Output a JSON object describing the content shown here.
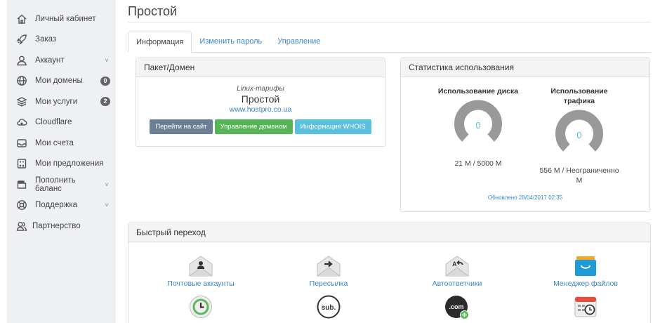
{
  "sidebar": {
    "items": [
      {
        "label": "Личный кабинет",
        "icon": "home-icon"
      },
      {
        "label": "Заказ",
        "icon": "rocket-icon"
      },
      {
        "label": "Аккаунт",
        "icon": "user-icon",
        "chevron": "˅"
      },
      {
        "label": "Мои домены",
        "icon": "globe-icon",
        "badge": "0"
      },
      {
        "label": "Мои услуги",
        "icon": "layers-icon",
        "badge": "2"
      },
      {
        "label": "Cloudflare",
        "icon": "cloud-icon"
      },
      {
        "label": "Мои счета",
        "icon": "inbox-icon"
      },
      {
        "label": "Мои предложения",
        "icon": "calculator-icon"
      },
      {
        "label": "Пополнить баланс",
        "icon": "wallet-icon",
        "chevron": "˅"
      },
      {
        "label": "Поддержка",
        "icon": "lifebuoy-icon",
        "chevron": "˅"
      },
      {
        "label": "Партнерство",
        "icon": "users-icon"
      }
    ]
  },
  "page": {
    "title": "Простой"
  },
  "tabs": [
    {
      "label": "Информация"
    },
    {
      "label": "Изменить пароль"
    },
    {
      "label": "Управление"
    }
  ],
  "package": {
    "heading": "Пакет/Домен",
    "group": "Linux-тарифы",
    "name": "Простой",
    "domain": "www.hostpro.co.ua",
    "buttons": {
      "goto_site": "Перейти на сайт",
      "manage_domain": "Управление доменом",
      "whois": "Информация WHOIS"
    }
  },
  "stats": {
    "heading": "Статистика использования",
    "disk": {
      "title": "Использование диска",
      "gauge_value": "0",
      "usage": "21 M / 5000 M"
    },
    "traffic": {
      "title_line1": "Использование",
      "title_line2": "трафика",
      "gauge_value": "0",
      "usage_line1": "556 M / Неограниченно",
      "usage_line2": "M"
    },
    "updated": "Обновлено 28/04/2017 02:35"
  },
  "quick": {
    "heading": "Быстрый переход",
    "items": [
      {
        "label": "Почтовые аккаунты",
        "icon": "mail-account-icon"
      },
      {
        "label": "Пересылка",
        "icon": "mail-forward-icon"
      },
      {
        "label": "Автоответчики",
        "icon": "mail-autoreply-icon"
      },
      {
        "label": "Менеджер файлов",
        "icon": "file-manager-icon"
      },
      {
        "label": "",
        "icon": "cron-clock-icon"
      },
      {
        "label": "",
        "icon": "subdomain-icon",
        "text": "sub."
      },
      {
        "label": "",
        "icon": "addon-domain-icon",
        "text": ".com"
      },
      {
        "label": "",
        "icon": "calendar-clock-icon"
      }
    ]
  },
  "colors": {
    "accent": "#3a86c4",
    "sidebar_bg": "#eef0f3",
    "btn_grey": "#6b7f95",
    "btn_green": "#56b456",
    "btn_blue": "#5bc0de",
    "gauge": "#999999"
  }
}
